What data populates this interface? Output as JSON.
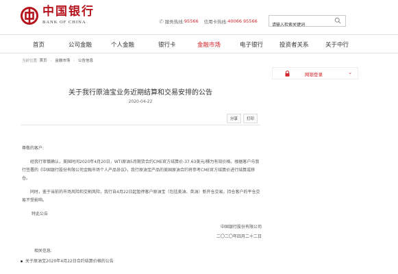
{
  "header": {
    "logo_cn": "中国银行",
    "logo_en": "BANK OF CHINA",
    "service_label": "服务热线:",
    "service_number": "95566",
    "card_label": "信用卡热线:",
    "card_number": "40066 95566",
    "search_placeholder": "请输入检索关键词"
  },
  "nav": {
    "items": [
      {
        "label": "首页"
      },
      {
        "label": "公司金融"
      },
      {
        "label": "个人金融"
      },
      {
        "label": "银行卡"
      },
      {
        "label": "金融市场"
      },
      {
        "label": "电子银行"
      },
      {
        "label": "投资者关系"
      },
      {
        "label": "关于中行"
      }
    ],
    "active_color": "#d2232a"
  },
  "breadcrumb": {
    "prefix": "当前位置:",
    "items": [
      "首页",
      "金融市场",
      "公告信息"
    ]
  },
  "login": {
    "label": "网银登录"
  },
  "article": {
    "title": "关于我行原油宝业务近期结算和交易安排的公告",
    "date": "2020-04-22",
    "share": "分享",
    "print": "打印",
    "greeting": "尊敬的客户:",
    "para1": "经我行审慎确认，美国时间2020年4月20日，WTI原油5月期货合约CME官方结算价-37.63美元/桶为有效价格。根据客户与我行签署的《中国银行股份有限公司金融市场个人产品协议》，我行原油宝产品的美国原油合约将参考CME官方结算价进行结算或移仓。",
    "para2": "同时，鉴于当前的市场风险和交割风险，我行自4月22日起暂停客户原油宝（包括美油、英油）新开仓交易，持仓客户的平仓交易不受影响。",
    "closing": "特此公告",
    "sign_org": "中国银行股份有限公司",
    "sign_date": "二〇二〇年四月二十二日"
  },
  "related": {
    "title": "相关信息:",
    "items": [
      "关于原油宝2020年4月22日合约结算价格的公告"
    ]
  }
}
